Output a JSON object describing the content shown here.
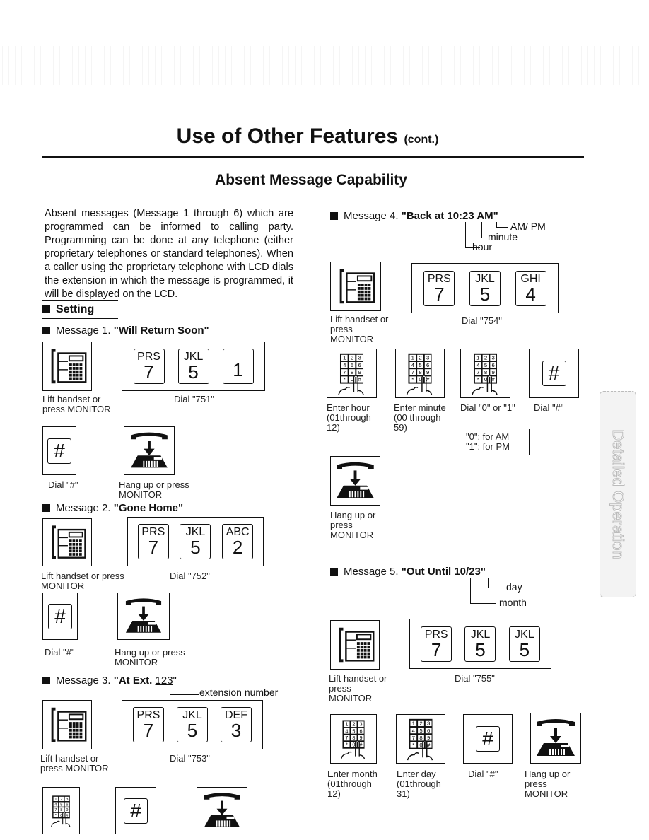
{
  "page": {
    "title": "Use of Other Features",
    "title_suffix": "(cont.)",
    "section": "Absent Message Capability",
    "side_tab": "Detailed Operation"
  },
  "intro": "Absent messages (Message 1 through 6) which are programmed can be informed to calling party. Programming can be done at any telephone (either proprietary telephones or standard telephones). When a caller using the proprietary telephone with LCD dials the extension in which the message is programmed, it will be displayed on the LCD.",
  "setting": "Setting",
  "common": {
    "lift": "Lift handset or press MONITOR",
    "dial_hash": "Dial \"#\"",
    "hang_up": "Hang up or press MONITOR",
    "hash": "#"
  },
  "m1": {
    "prefix": "Message 1. ",
    "text": "\"Will Return Soon\"",
    "dial": "Dial \"751\"",
    "keys": [
      {
        "l": "PRS",
        "n": "7"
      },
      {
        "l": "JKL",
        "n": "5"
      },
      {
        "l": "",
        "n": "1"
      }
    ]
  },
  "m2": {
    "prefix": "Message 2. ",
    "text": "\"Gone Home\"",
    "dial": "Dial \"752\"",
    "keys": [
      {
        "l": "PRS",
        "n": "7"
      },
      {
        "l": "JKL",
        "n": "5"
      },
      {
        "l": "ABC",
        "n": "2"
      }
    ]
  },
  "m3": {
    "prefix": "Message 3. ",
    "text": "\"At Ext. ",
    "num": "123",
    "close": "\"",
    "ann": "extension number",
    "dial": "Dial \"753\"",
    "keys": [
      {
        "l": "PRS",
        "n": "7"
      },
      {
        "l": "JKL",
        "n": "5"
      },
      {
        "l": "DEF",
        "n": "3"
      }
    ]
  },
  "m4": {
    "prefix": "Message 4. ",
    "text": "\"Back at 10:23 AM\"",
    "ann_ampm": "AM/ PM",
    "ann_min": "minute",
    "ann_hour": "hour",
    "dial": "Dial \"754\"",
    "keys": [
      {
        "l": "PRS",
        "n": "7"
      },
      {
        "l": "JKL",
        "n": "5"
      },
      {
        "l": "GHI",
        "n": "4"
      }
    ],
    "enter_hour": "Enter hour (01through 12)",
    "enter_minute": "Enter minute (00 through 59)",
    "dial_01": "Dial \"0\" or \"1\"",
    "am": "\"0\": for AM",
    "pm": "\"1\": for PM"
  },
  "m5": {
    "prefix": "Message 5. ",
    "text": "\"Out Until 10/23\"",
    "ann_day": "day",
    "ann_month": "month",
    "dial": "Dial \"755\"",
    "keys": [
      {
        "l": "PRS",
        "n": "7"
      },
      {
        "l": "JKL",
        "n": "5"
      },
      {
        "l": "JKL",
        "n": "5"
      }
    ],
    "enter_month": "Enter month (01through 12)",
    "enter_day": "Enter day (01through 31)"
  }
}
